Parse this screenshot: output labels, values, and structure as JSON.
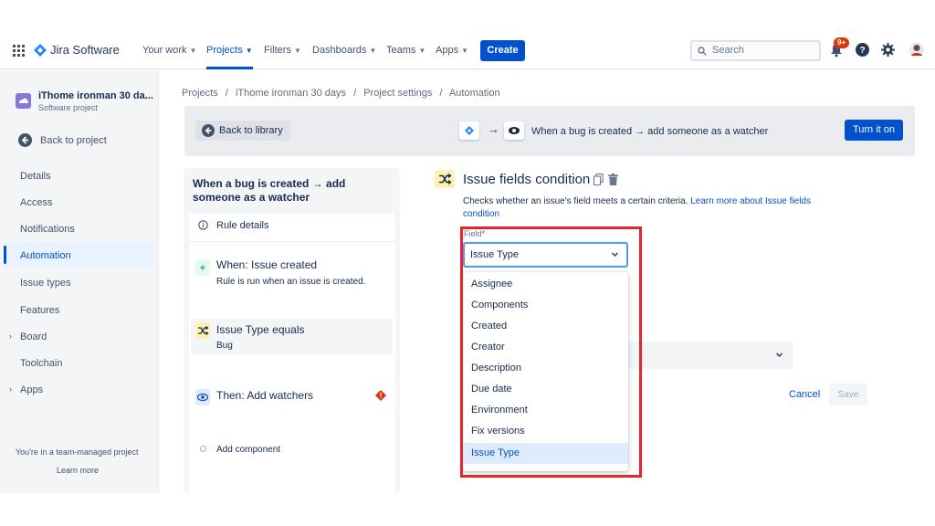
{
  "nav": {
    "product": "Jira Software",
    "items": [
      {
        "label": "Your work"
      },
      {
        "label": "Projects"
      },
      {
        "label": "Filters"
      },
      {
        "label": "Dashboards"
      },
      {
        "label": "Teams"
      },
      {
        "label": "Apps"
      }
    ],
    "create_label": "Create",
    "search_placeholder": "Search",
    "notification_badge": "9+"
  },
  "sidebar": {
    "project_name": "iThome ironman 30 da...",
    "project_type": "Software project",
    "back_label": "Back to project",
    "items": [
      {
        "label": "Details"
      },
      {
        "label": "Access"
      },
      {
        "label": "Notifications"
      },
      {
        "label": "Automation"
      },
      {
        "label": "Issue types"
      },
      {
        "label": "Features"
      },
      {
        "label": "Board"
      },
      {
        "label": "Toolchain"
      },
      {
        "label": "Apps"
      }
    ],
    "footer_text": "You're in a team-managed project",
    "learn_more": "Learn more"
  },
  "breadcrumb": {
    "items": [
      "Projects",
      "iThome ironman 30 days",
      "Project settings",
      "Automation"
    ],
    "separator": "/"
  },
  "toolbar": {
    "back_library": "Back to library",
    "rule_summary": "When a bug is created → add someone as a watcher",
    "turn_on": "Turn it on"
  },
  "rule": {
    "title": "When a bug is created → add someone as a watcher",
    "details_label": "Rule details",
    "trigger_title": "When: Issue created",
    "trigger_desc": "Rule is run when an issue is created.",
    "condition_title": "Issue Type equals",
    "condition_value": "Bug",
    "action_title": "Then: Add watchers",
    "add_component": "Add component"
  },
  "condition": {
    "title": "Issue fields condition",
    "description": "Checks whether an issue's field meets a certain criteria.",
    "learn_link": "Learn more about Issue fields condition",
    "field_label": "Field",
    "required_mark": "*",
    "field_value": "Issue Type",
    "options": [
      "Assignee",
      "Components",
      "Created",
      "Creator",
      "Description",
      "Due date",
      "Environment",
      "Fix versions",
      "Issue Type"
    ],
    "selected_option": "Issue Type",
    "cancel": "Cancel",
    "save": "Save"
  },
  "colors": {
    "brand": "#0052cc",
    "highlight_box": "#e5262e",
    "error": "#de350b",
    "condition_icon_bg": "#fff0b3"
  }
}
